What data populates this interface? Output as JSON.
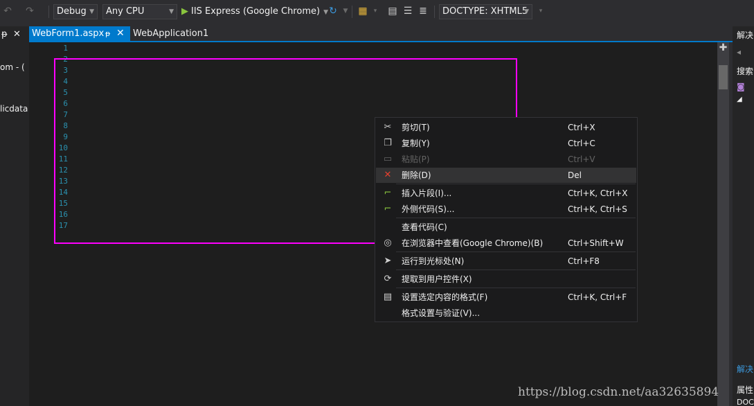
{
  "toolbar": {
    "config": "Debug",
    "platform": "Any CPU",
    "run_target": "IIS Express (Google Chrome)",
    "doctype": "DOCTYPE: XHTML5"
  },
  "left_pane": {
    "pin": "ᵽ",
    "close": "✕",
    "item1": "om - (",
    "item2": "licdata"
  },
  "tabs": [
    {
      "label": "WebForm1.aspx",
      "active": true
    },
    {
      "label": "WebApplication1",
      "active": false
    }
  ],
  "editor": {
    "line_numbers": [
      "1",
      "2",
      "3",
      "4",
      "5",
      "6",
      "7",
      "8",
      "9",
      "10",
      "11",
      "12",
      "13",
      "14",
      "15",
      "16",
      "17"
    ]
  },
  "right_pane": {
    "solution": "解决",
    "search": "搜索",
    "solution2": "解决",
    "properties": "属性",
    "doc": "DOC"
  },
  "context_menu": {
    "items": [
      {
        "label": "剪切(T)",
        "shortcut": "Ctrl+X",
        "icon": "scissors-icon",
        "enabled": true
      },
      {
        "label": "复制(Y)",
        "shortcut": "Ctrl+C",
        "icon": "copy-icon",
        "enabled": true
      },
      {
        "label": "粘贴(P)",
        "shortcut": "Ctrl+V",
        "icon": "paste-icon",
        "enabled": false
      },
      {
        "label": "删除(D)",
        "shortcut": "Del",
        "icon": "delete-icon",
        "enabled": true
      },
      {
        "label": "插入片段(I)...",
        "shortcut": "Ctrl+K, Ctrl+X",
        "icon": "snippet-icon",
        "enabled": true
      },
      {
        "label": "外侧代码(S)...",
        "shortcut": "Ctrl+K, Ctrl+S",
        "icon": "surround-icon",
        "enabled": true
      },
      {
        "label": "查看代码(C)",
        "shortcut": "",
        "icon": "",
        "enabled": true
      },
      {
        "label": "在浏览器中查看(Google Chrome)(B)",
        "shortcut": "Ctrl+Shift+W",
        "icon": "browser-icon",
        "enabled": true
      },
      {
        "label": "运行到光标处(N)",
        "shortcut": "Ctrl+F8",
        "icon": "cursor-icon",
        "enabled": true
      },
      {
        "label": "提取到用户控件(X)",
        "shortcut": "",
        "icon": "extract-icon",
        "enabled": true
      },
      {
        "label": "设置选定内容的格式(F)",
        "shortcut": "Ctrl+K, Ctrl+F",
        "icon": "format-icon",
        "enabled": true
      },
      {
        "label": "格式设置与验证(V)...",
        "shortcut": "",
        "icon": "",
        "enabled": true
      }
    ]
  },
  "watermark": "https://blog.csdn.net/aa32635894"
}
